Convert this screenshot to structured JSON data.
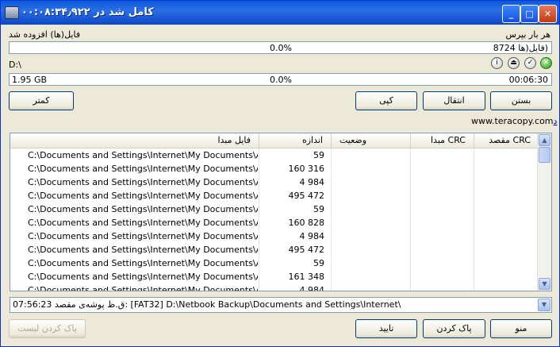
{
  "window": {
    "title": "کامل شد در ۰۰:۰۸:۳۴٫۹۲۲",
    "minimize": "_",
    "maximize": "□",
    "close": "✕"
  },
  "top_left_label": "فایل(ها) افزوده شد",
  "top_right_label": "هر بار بپرس",
  "file_progress": {
    "left": "0.0%",
    "right": "(فایل(ها 8724",
    "fraction": 0.0
  },
  "drive_label": "D:\\",
  "total_progress": {
    "size": "1.95 GB",
    "percent": "0.0%",
    "time": "00:06:30",
    "fraction": 0.0
  },
  "status_icons": [
    "info-icon",
    "eject-icon",
    "check-icon",
    "cancel-icon"
  ],
  "buttons": {
    "less": "کمتر",
    "copy": "کپی",
    "move": "انتقال",
    "close": "بستن",
    "clear_list": "پاک کردن لیست",
    "confirm": "تایید",
    "clear": "پاک کردن",
    "menu": "منو"
  },
  "link": {
    "text": "www.teracopy.com",
    "suffix": "د"
  },
  "grid": {
    "headers": {
      "src": "فایل مبدا",
      "size": "اندازه",
      "status": "وضعیت",
      "src_crc": "CRC مبدا",
      "dst_crc": "CRC مقصد"
    },
    "rows": [
      {
        "src": "C:\\Documents and Settings\\Internet\\My Documents\\Acce...",
        "size": "59"
      },
      {
        "src": "C:\\Documents and Settings\\Internet\\My Documents\\Acce...",
        "size": "160 316"
      },
      {
        "src": "C:\\Documents and Settings\\Internet\\My Documents\\Acce...",
        "size": "4 984"
      },
      {
        "src": "C:\\Documents and Settings\\Internet\\My Documents\\Acce...",
        "size": "495 472"
      },
      {
        "src": "C:\\Documents and Settings\\Internet\\My Documents\\Acce...",
        "size": "59"
      },
      {
        "src": "C:\\Documents and Settings\\Internet\\My Documents\\Acce...",
        "size": "160 828"
      },
      {
        "src": "C:\\Documents and Settings\\Internet\\My Documents\\Acce...",
        "size": "4 984"
      },
      {
        "src": "C:\\Documents and Settings\\Internet\\My Documents\\Acce...",
        "size": "495 472"
      },
      {
        "src": "C:\\Documents and Settings\\Internet\\My Documents\\Acce...",
        "size": "59"
      },
      {
        "src": "C:\\Documents and Settings\\Internet\\My Documents\\Acce...",
        "size": "161 348"
      },
      {
        "src": "C:\\Documents and Settings\\Internet\\My Documents\\Acce...",
        "size": "4 984"
      }
    ]
  },
  "log_combo": "07:56:23 ق.ظ پوشه‌ی مقصد: [FAT32] D:\\Netbook Backup\\Documents and Settings\\Internet\\"
}
